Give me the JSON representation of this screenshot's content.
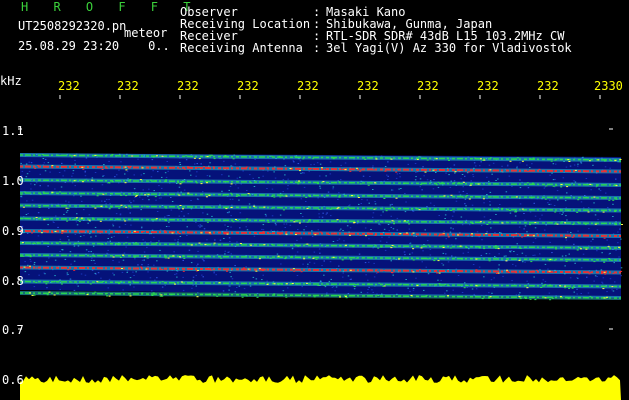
{
  "header": {
    "logo": "H R O F F T",
    "filename": "UT2508292320.pn",
    "tag": "meteor",
    "timestamp": "25.08.29 23:20",
    "timestamp_suffix": "0..",
    "info": [
      {
        "label": "Observer",
        "value": "Masaki Kano"
      },
      {
        "label": "Receiving Location",
        "value": "Shibukawa, Gunma, Japan"
      },
      {
        "label": "Receiver",
        "value": "RTL-SDR SDR# 43dB L15 103.2MHz CW"
      },
      {
        "label": "Receiving Antenna",
        "value": "3el Yagi(V) Az 330 for Vladivostok"
      }
    ]
  },
  "axes": {
    "y_unit": "kHz",
    "x_ticks": [
      "232",
      "232",
      "232",
      "232",
      "232",
      "232",
      "232",
      "232",
      "232",
      "2330"
    ],
    "y_ticks": [
      "1.1",
      "1.0",
      "0.9",
      "0.8",
      "0.7",
      "0.6"
    ]
  },
  "colors": {
    "background": "#000000",
    "spectrum_bg": "#05127a",
    "label_green": "#3bd13b",
    "label_yellow": "#ffff00",
    "signal_red": "#ff2a2a",
    "signal_green": "#2be04a",
    "signal_cyan": "#29c6d6"
  },
  "spectrum": {
    "y_range_khz": [
      0.6,
      1.1
    ],
    "bands_khz": [
      1.048,
      1.025,
      0.998,
      0.972,
      0.947,
      0.921,
      0.896,
      0.872,
      0.848,
      0.823,
      0.795,
      0.772
    ],
    "strong_bands_khz": [
      1.025,
      0.896,
      0.823
    ]
  }
}
